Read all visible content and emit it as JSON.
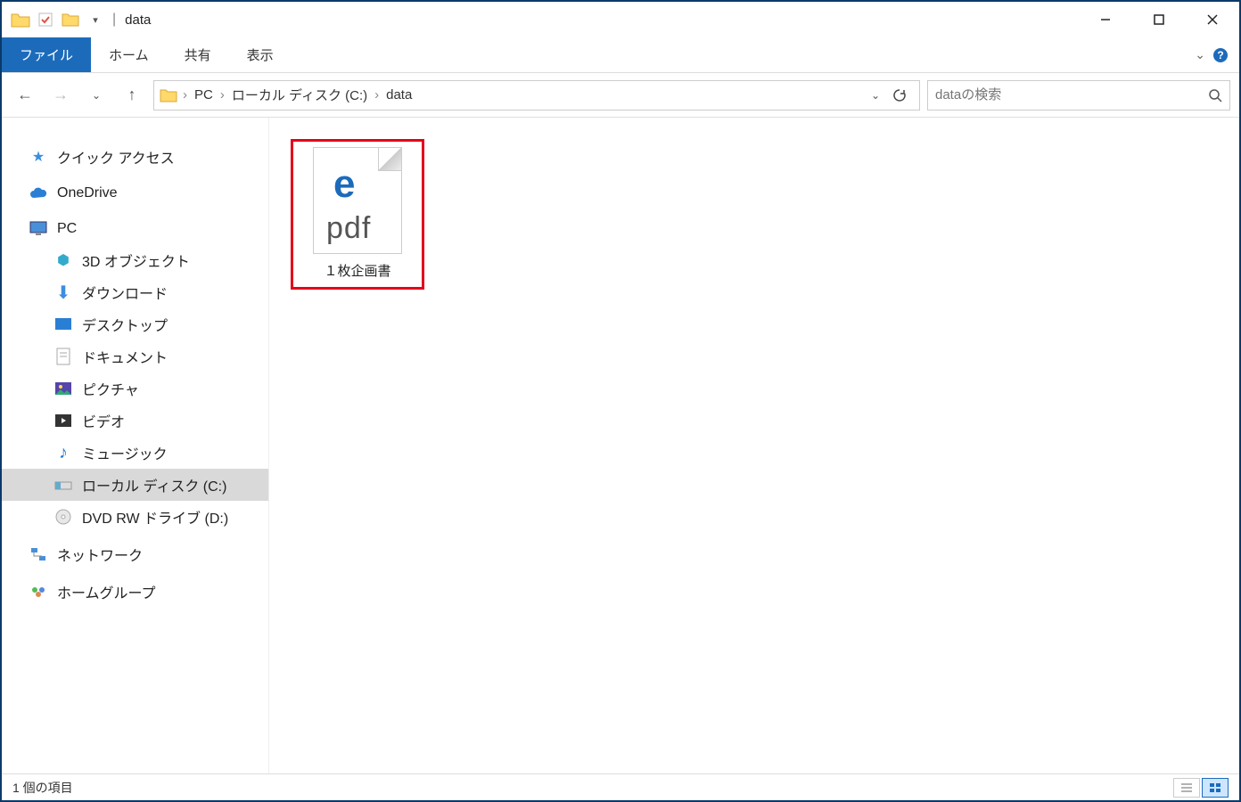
{
  "window": {
    "title": "data"
  },
  "ribbon": {
    "file": "ファイル",
    "tabs": [
      "ホーム",
      "共有",
      "表示"
    ]
  },
  "breadcrumb": {
    "segments": [
      "PC",
      "ローカル ディスク (C:)",
      "data"
    ]
  },
  "search": {
    "placeholder": "dataの検索"
  },
  "sidebar": {
    "quick_access": "クイック アクセス",
    "onedrive": "OneDrive",
    "pc": "PC",
    "pc_children": [
      "3D オブジェクト",
      "ダウンロード",
      "デスクトップ",
      "ドキュメント",
      "ピクチャ",
      "ビデオ",
      "ミュージック",
      "ローカル ディスク (C:)",
      "DVD RW ドライブ (D:)"
    ],
    "network": "ネットワーク",
    "homegroup": "ホームグループ"
  },
  "files": [
    {
      "name": "１枚企画書",
      "ext": "pdf",
      "app": "e"
    }
  ],
  "status": {
    "text": "1 個の項目"
  }
}
